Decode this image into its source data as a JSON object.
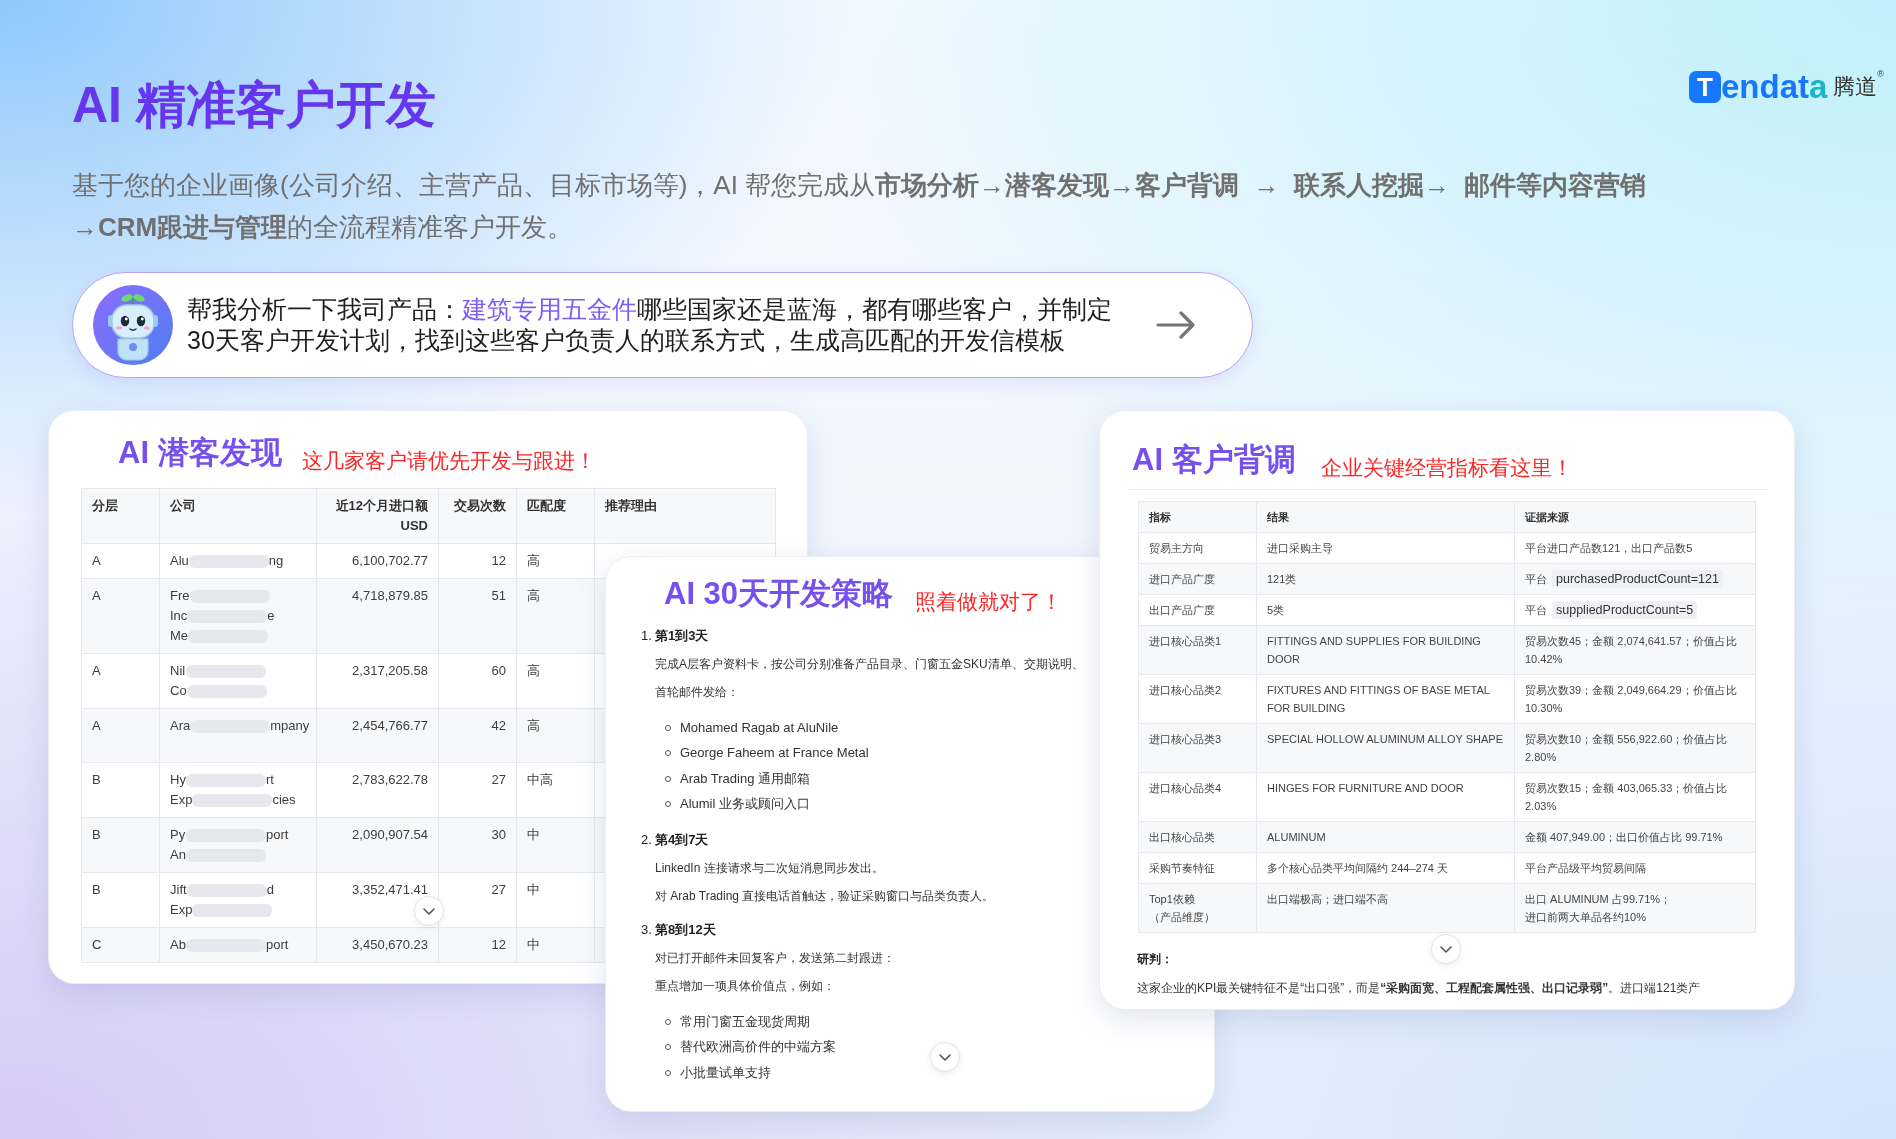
{
  "header": {
    "title": "AI 精准客户开发",
    "logo": {
      "mark": "T",
      "word": "endat",
      "word_end": "a",
      "chinese": "腾道",
      "registered": "®"
    }
  },
  "intro": "基于您的企业画像(公司介绍、主营产品、目标市场等)，AI 帮您完成从**市场分析→潜客发现→客户背调  →  联系人挖掘→  邮件等内容营销→CRM跟进与管理**的全流程精准客户开发。",
  "prompt": {
    "before": "帮我分析一下我司产品：",
    "highlight": "建筑专用五金件",
    "after": "哪些国家还是蓝海，都有哪些客户，并制定30天客户开发计划，找到这些客户负责人的联系方式，生成高匹配的开发信模板"
  },
  "prospects": {
    "title": "AI 潜客发现",
    "callout": "这几家客户请优先开发与跟进！",
    "columns": [
      {
        "label": "分层",
        "kind": "text"
      },
      {
        "label": "公司",
        "kind": "text"
      },
      {
        "label": "近12个月进口额 USD",
        "kind": "number"
      },
      {
        "label": "交易次数",
        "kind": "number"
      },
      {
        "label": "匹配度",
        "kind": "text"
      },
      {
        "label": "推荐理由",
        "kind": "text"
      }
    ],
    "rows": [
      {
        "tier": "A",
        "company": [
          {
            "start": "Alu",
            "end": "ng"
          }
        ],
        "amount": "6,100,702.77",
        "deals": "12",
        "match": "高"
      },
      {
        "tier": "A",
        "company": [
          {
            "start": "Fre"
          },
          {
            "start": "Inc",
            "end": "e"
          },
          {
            "start": "Me"
          }
        ],
        "amount": "4,718,879.85",
        "deals": "51",
        "match": "高"
      },
      {
        "tier": "A",
        "company": [
          {
            "start": "Nil"
          },
          {
            "start": "Co"
          }
        ],
        "amount": "2,317,205.58",
        "deals": "60",
        "match": "高"
      },
      {
        "tier": "A",
        "company": [
          {
            "start": "Ara",
            "end": "mpany"
          }
        ],
        "amount": "2,454,766.77",
        "deals": "42",
        "match": "高"
      },
      {
        "tier": "B",
        "company": [
          {
            "start": "Hy",
            "end": "rt"
          },
          {
            "start": "Exp",
            "end": "cies"
          }
        ],
        "amount": "2,783,622.78",
        "deals": "27",
        "match": "中高"
      },
      {
        "tier": "B",
        "company": [
          {
            "start": "Py",
            "end": "port"
          },
          {
            "start": "An"
          }
        ],
        "amount": "2,090,907.54",
        "deals": "30",
        "match": "中"
      },
      {
        "tier": "B",
        "company": [
          {
            "start": "Jift",
            "end": "d"
          },
          {
            "start": "Exp"
          }
        ],
        "amount": "3,352,471.41",
        "deals": "27",
        "match": "中"
      },
      {
        "tier": "C",
        "company": [
          {
            "start": "Ab",
            "end": "port"
          }
        ],
        "amount": "3,450,670.23",
        "deals": "12",
        "match": "中"
      }
    ]
  },
  "plan": {
    "title": "AI 30天开发策略",
    "callout": "照着做就对了！",
    "steps": [
      {
        "number": "1.",
        "title": "第1到3天",
        "lines": [
          "完成A层客户资料卡，按公司分别准备产品目录、门窗五金SKU清单、交期说明、",
          "首轮邮件发给："
        ],
        "bullets": [
          "Mohamed Ragab at AluNile",
          "George Faheem at France Metal",
          "Arab Trading 通用邮箱",
          "Alumil 业务或顾问入口"
        ]
      },
      {
        "number": "2.",
        "title": "第4到7天",
        "lines": [
          "LinkedIn 连接请求与二次短消息同步发出。",
          "对 Arab Trading 直接电话首触达，验证采购窗口与品类负责人。"
        ]
      },
      {
        "number": "3.",
        "title": "第8到12天",
        "lines": [
          "对已打开邮件未回复客户，发送第二封跟进：",
          "重点增加一项具体价值点，例如："
        ],
        "bullets": [
          "常用门窗五金现货周期",
          "替代欧洲高价件的中端方案",
          "小批量试单支持"
        ]
      }
    ]
  },
  "research": {
    "title": "AI 客户背调",
    "callout": "企业关键经营指标看这里！",
    "columns": [
      "指标",
      "结果",
      "证据来源"
    ],
    "rows": [
      {
        "metric": [
          "贸易主方向"
        ],
        "result": "进口采购主导",
        "evidence": [
          "平台进口产品数121，出口产品数5"
        ]
      },
      {
        "metric": [
          "进口产品广度"
        ],
        "result": "121类",
        "evidence": [
          "平台"
        ],
        "evidence_code": "purchasedProductCount=121"
      },
      {
        "metric": [
          "出口产品广度"
        ],
        "result": "5类",
        "evidence": [
          "平台"
        ],
        "evidence_code": "suppliedProductCount=5"
      },
      {
        "metric": [
          "进口核心品类1"
        ],
        "result": "FITTINGS AND SUPPLIES FOR BUILDING DOOR",
        "evidence": [
          "贸易次数45；金额 2,074,641.57；价值占比 10.42%"
        ]
      },
      {
        "metric": [
          "进口核心品类2"
        ],
        "result": "FIXTURES AND FITTINGS OF BASE METAL FOR BUILDING",
        "evidence": [
          "贸易次数39；金额 2,049,664.29；价值占比 10.30%"
        ]
      },
      {
        "metric": [
          "进口核心品类3"
        ],
        "result": "SPECIAL HOLLOW ALUMINUM ALLOY SHAPE",
        "evidence": [
          "贸易次数10；金额 556,922.60；价值占比 2.80%"
        ]
      },
      {
        "metric": [
          "进口核心品类4"
        ],
        "result": "HINGES FOR FURNITURE AND DOOR",
        "evidence": [
          "贸易次数15；金额 403,065.33；价值占比 2.03%"
        ]
      },
      {
        "metric": [
          "出口核心品类"
        ],
        "result": "ALUMINUM",
        "evidence": [
          "金额 407,949.00；出口价值占比 99.71%"
        ]
      },
      {
        "metric": [
          "采购节奏特征"
        ],
        "result": "多个核心品类平均间隔约 244–274 天",
        "evidence": [
          "平台产品级平均贸易间隔"
        ]
      },
      {
        "metric": [
          "Top1依赖",
          "（产品维度）"
        ],
        "result": "出口端极高；进口端不高",
        "evidence": [
          "出口 ALUMINUM 占99.71%；",
          "进口前两大单品各约10%"
        ]
      }
    ],
    "verdict_label": "研判：",
    "verdict": "这家企业的KPI最关键特征不是“出口强”，而是**“采购面宽、工程配套属性强、出口记录弱”**。进口端121类产"
  }
}
